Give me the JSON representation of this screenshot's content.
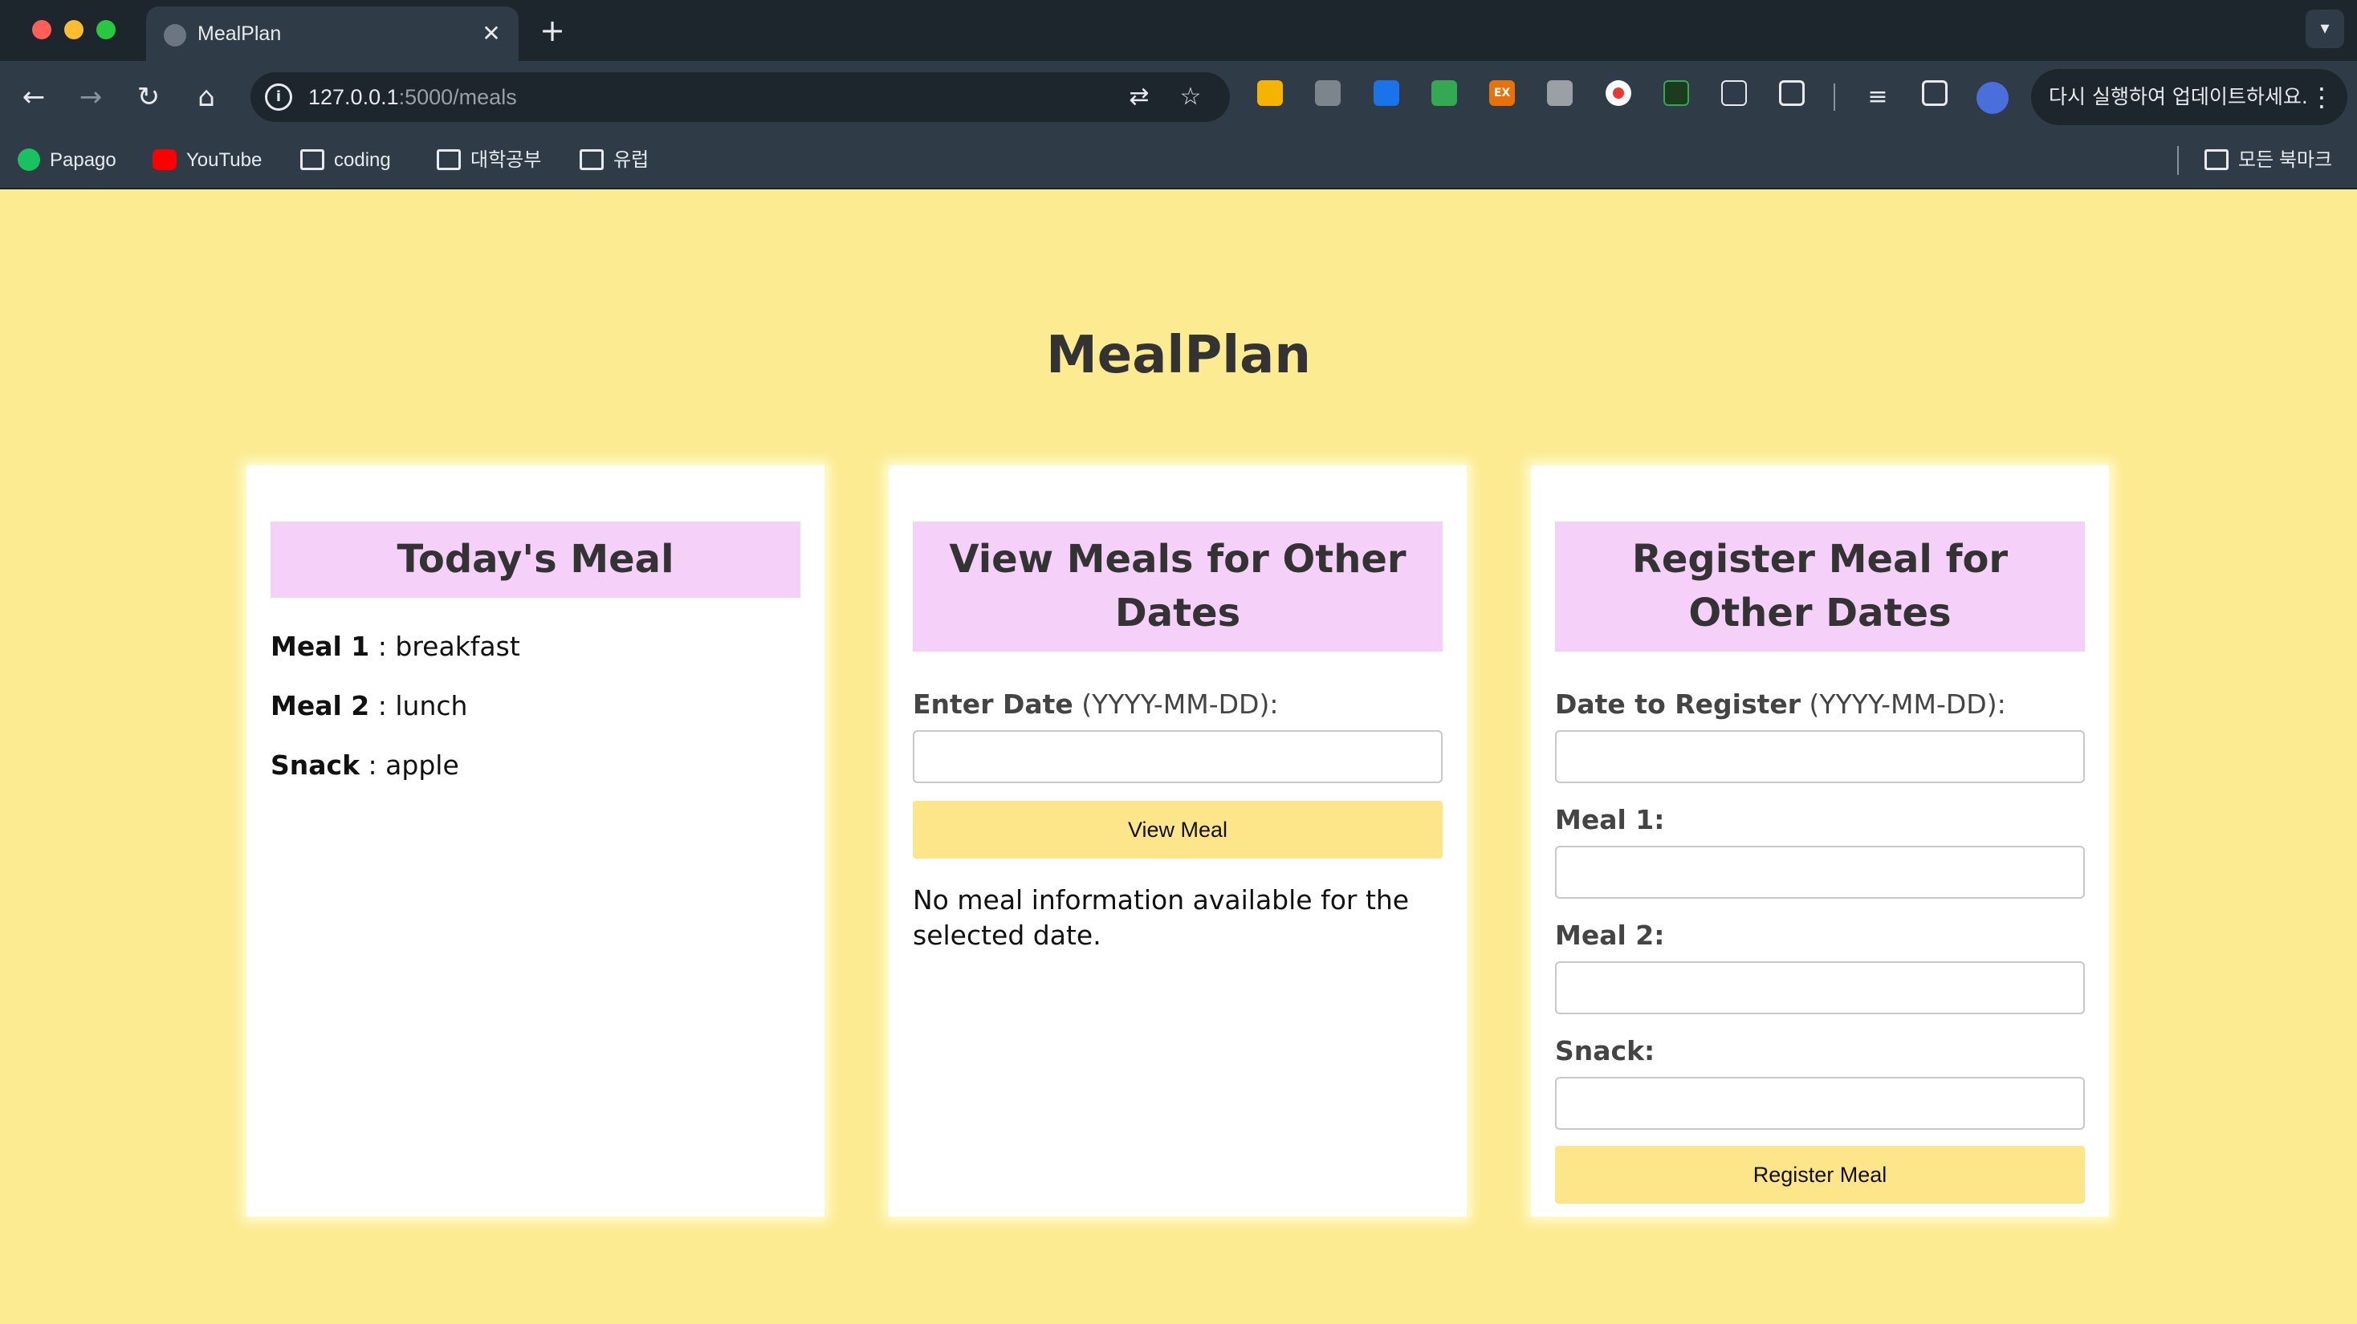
{
  "browser": {
    "tab_title": "MealPlan",
    "tab_close": "✕",
    "new_tab": "+",
    "url_host": "127.0.0.1",
    "url_path": ":5000/meals",
    "update_text": "다시 실행하여 업데이트하세요.",
    "bookmarks": [
      {
        "label": "Papago",
        "icon": "papago-icon"
      },
      {
        "label": "YouTube",
        "icon": "youtube-icon"
      },
      {
        "label": "coding",
        "icon": "folder-icon"
      },
      {
        "label": "대학공부",
        "icon": "folder-icon"
      },
      {
        "label": "유럽",
        "icon": "folder-icon"
      }
    ],
    "all_bookmarks": "모든 북마크"
  },
  "page": {
    "title": "MealPlan"
  },
  "today": {
    "header": "Today's Meal",
    "items": [
      {
        "label": "Meal 1",
        "sep": " : ",
        "value": "breakfast"
      },
      {
        "label": "Meal 2",
        "sep": " : ",
        "value": "lunch"
      },
      {
        "label": "Snack",
        "sep": " : ",
        "value": "apple"
      }
    ]
  },
  "view": {
    "header": "View Meals for Other Dates",
    "date_label_bold": "Enter Date",
    "date_label_rest": " (YYYY-MM-DD):",
    "date_value": "",
    "button": "View Meal",
    "result": "No meal information available for the selected date."
  },
  "register": {
    "header": "Register Meal for Other Dates",
    "date_label_bold": "Date to Register",
    "date_label_rest": " (YYYY-MM-DD):",
    "meal1_label": "Meal 1:",
    "meal2_label": "Meal 2:",
    "snack_label": "Snack:",
    "date_value": "",
    "meal1_value": "",
    "meal2_value": "",
    "snack_value": "",
    "button": "Register Meal"
  },
  "colors": {
    "page_background": "#fdeb91",
    "header_background": "#f5d0f8",
    "button_background": "#fde58a"
  }
}
